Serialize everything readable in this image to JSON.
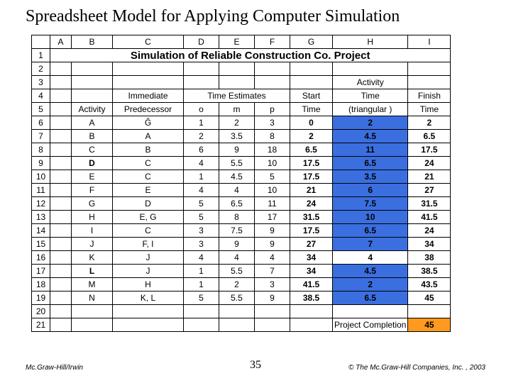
{
  "slide": {
    "title": "Spreadsheet Model for Applying Computer Simulation"
  },
  "cols": [
    "A",
    "B",
    "C",
    "D",
    "E",
    "F",
    "G",
    "H",
    "I"
  ],
  "rownums": [
    "1",
    "2",
    "3",
    "4",
    "5",
    "6",
    "7",
    "8",
    "9",
    "10",
    "11",
    "12",
    "13",
    "14",
    "15",
    "16",
    "17",
    "18",
    "19",
    "20",
    "21"
  ],
  "sheet_title": "Simulation of Reliable Construction Co. Project",
  "headers": {
    "r3_H": "Activity",
    "r4_C": "Immediate",
    "r4_DEF": "Time Estimates",
    "r4_G": "Start",
    "r4_H": "Time",
    "r4_I": "Finish",
    "r5_B": "Activity",
    "r5_C": "Predecessor",
    "r5_D": "o",
    "r5_E": "m",
    "r5_F": "p",
    "r5_G": "Time",
    "r5_H": "(triangular )",
    "r5_I": "Time"
  },
  "rows": [
    {
      "act": "A",
      "pred": "Ĝ",
      "o": "1",
      "m": "2",
      "p": "3",
      "start": "0",
      "atime": "2",
      "finish": "2"
    },
    {
      "act": "B",
      "pred": "A",
      "o": "2",
      "m": "3.5",
      "p": "8",
      "start": "2",
      "atime": "4.5",
      "finish": "6.5"
    },
    {
      "act": "C",
      "pred": "B",
      "o": "6",
      "m": "9",
      "p": "18",
      "start": "6.5",
      "atime": "11",
      "finish": "17.5"
    },
    {
      "act": "D",
      "pred": "C",
      "o": "4",
      "m": "5.5",
      "p": "10",
      "start": "17.5",
      "atime": "6.5",
      "finish": "24"
    },
    {
      "act": "E",
      "pred": "C",
      "o": "1",
      "m": "4.5",
      "p": "5",
      "start": "17.5",
      "atime": "3.5",
      "finish": "21"
    },
    {
      "act": "F",
      "pred": "E",
      "o": "4",
      "m": "4",
      "p": "10",
      "start": "21",
      "atime": "6",
      "finish": "27"
    },
    {
      "act": "G",
      "pred": "D",
      "o": "5",
      "m": "6.5",
      "p": "11",
      "start": "24",
      "atime": "7.5",
      "finish": "31.5"
    },
    {
      "act": "H",
      "pred": "E, G",
      "o": "5",
      "m": "8",
      "p": "17",
      "start": "31.5",
      "atime": "10",
      "finish": "41.5"
    },
    {
      "act": "I",
      "pred": "C",
      "o": "3",
      "m": "7.5",
      "p": "9",
      "start": "17.5",
      "atime": "6.5",
      "finish": "24"
    },
    {
      "act": "J",
      "pred": "F, I",
      "o": "3",
      "m": "9",
      "p": "9",
      "start": "27",
      "atime": "7",
      "finish": "34"
    },
    {
      "act": "K",
      "pred": "J",
      "o": "4",
      "m": "4",
      "p": "4",
      "start": "34",
      "atime": "4",
      "finish": "38"
    },
    {
      "act": "L",
      "pred": "J",
      "o": "1",
      "m": "5.5",
      "p": "7",
      "start": "34",
      "atime": "4.5",
      "finish": "38.5"
    },
    {
      "act": "M",
      "pred": "H",
      "o": "1",
      "m": "2",
      "p": "3",
      "start": "41.5",
      "atime": "2",
      "finish": "43.5"
    },
    {
      "act": "N",
      "pred": "K, L",
      "o": "5",
      "m": "5.5",
      "p": "9",
      "start": "38.5",
      "atime": "6.5",
      "finish": "45"
    }
  ],
  "completion": {
    "label": "Project Completion",
    "value": "45"
  },
  "footer": {
    "left": "Mc.Graw-Hill/Irwin",
    "center": "35",
    "right": "© The Mc.Graw-Hill Companies, Inc. , 2003"
  },
  "chart_data": {
    "type": "table",
    "title": "Simulation of Reliable Construction Co. Project",
    "columns": [
      "Activity",
      "Immediate Predecessor",
      "o",
      "m",
      "p",
      "Start Time",
      "Activity Time (triangular)",
      "Finish Time"
    ],
    "rows": [
      [
        "A",
        "Ĝ",
        1,
        2,
        3,
        0,
        2,
        2
      ],
      [
        "B",
        "A",
        2,
        3.5,
        8,
        2,
        4.5,
        6.5
      ],
      [
        "C",
        "B",
        6,
        9,
        18,
        6.5,
        11,
        17.5
      ],
      [
        "D",
        "C",
        4,
        5.5,
        10,
        17.5,
        6.5,
        24
      ],
      [
        "E",
        "C",
        1,
        4.5,
        5,
        17.5,
        3.5,
        21
      ],
      [
        "F",
        "E",
        4,
        4,
        10,
        21,
        6,
        27
      ],
      [
        "G",
        "D",
        5,
        6.5,
        11,
        24,
        7.5,
        31.5
      ],
      [
        "H",
        "E, G",
        5,
        8,
        17,
        31.5,
        10,
        41.5
      ],
      [
        "I",
        "C",
        3,
        7.5,
        9,
        17.5,
        6.5,
        24
      ],
      [
        "J",
        "F, I",
        3,
        9,
        9,
        27,
        7,
        34
      ],
      [
        "K",
        "J",
        4,
        4,
        4,
        34,
        4,
        38
      ],
      [
        "L",
        "J",
        1,
        5.5,
        7,
        34,
        4.5,
        38.5
      ],
      [
        "M",
        "H",
        1,
        2,
        3,
        41.5,
        2,
        43.5
      ],
      [
        "N",
        "K, L",
        5,
        5.5,
        9,
        38.5,
        6.5,
        45
      ]
    ],
    "project_completion": 45
  }
}
